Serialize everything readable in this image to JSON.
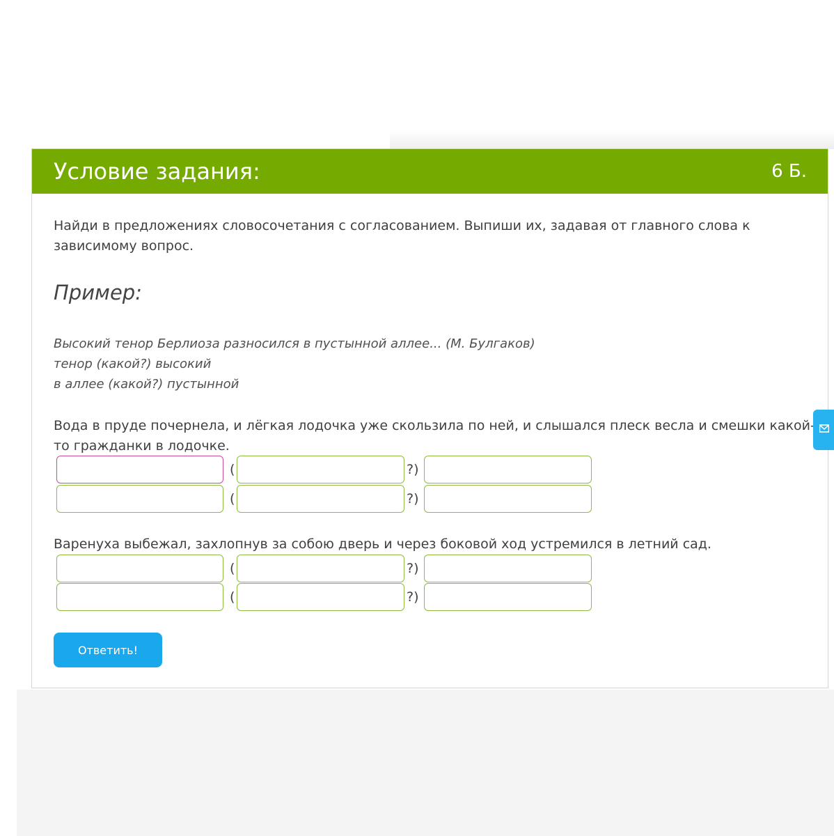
{
  "header": {
    "title": "Условие задания:",
    "points": "6 Б."
  },
  "task": {
    "instruction": "Найди в предложениях словосочетания с согласованием. Выпиши их, задавая от главного слова к зависимому вопрос.",
    "example_heading": "Пример:",
    "example_lines": [
      "Высокий тенор Берлиоза разносился в пустынной аллее... (М. Булгаков)",
      "тенор (какой?) высокий",
      "в аллее (какой?) пустынной"
    ]
  },
  "exercises": [
    {
      "sentence": "Вода в пруде почернела, и лёгкая лодочка уже скользила по ней, и слышался плеск весла и смешки какой-то гражданки в лодочке.",
      "rows": [
        {
          "open": "(",
          "close": "?)",
          "main": "",
          "question": "",
          "dependent": ""
        },
        {
          "open": "(",
          "close": "?)",
          "main": "",
          "question": "",
          "dependent": ""
        }
      ]
    },
    {
      "sentence": "Варенуха выбежал, захлопнув за собою дверь и через боковой ход устремился в летний сад.",
      "rows": [
        {
          "open": "(",
          "close": "?)",
          "main": "",
          "question": "",
          "dependent": ""
        },
        {
          "open": "(",
          "close": "?)",
          "main": "",
          "question": "",
          "dependent": ""
        }
      ]
    }
  ],
  "submit_label": "Ответить!",
  "side_tab_icon": "envelope-icon",
  "colors": {
    "header_green": "#75ab00",
    "field_border": "#8dbb41",
    "active_field_border": "#cc4a9b",
    "button_blue": "#1aa8ec"
  }
}
